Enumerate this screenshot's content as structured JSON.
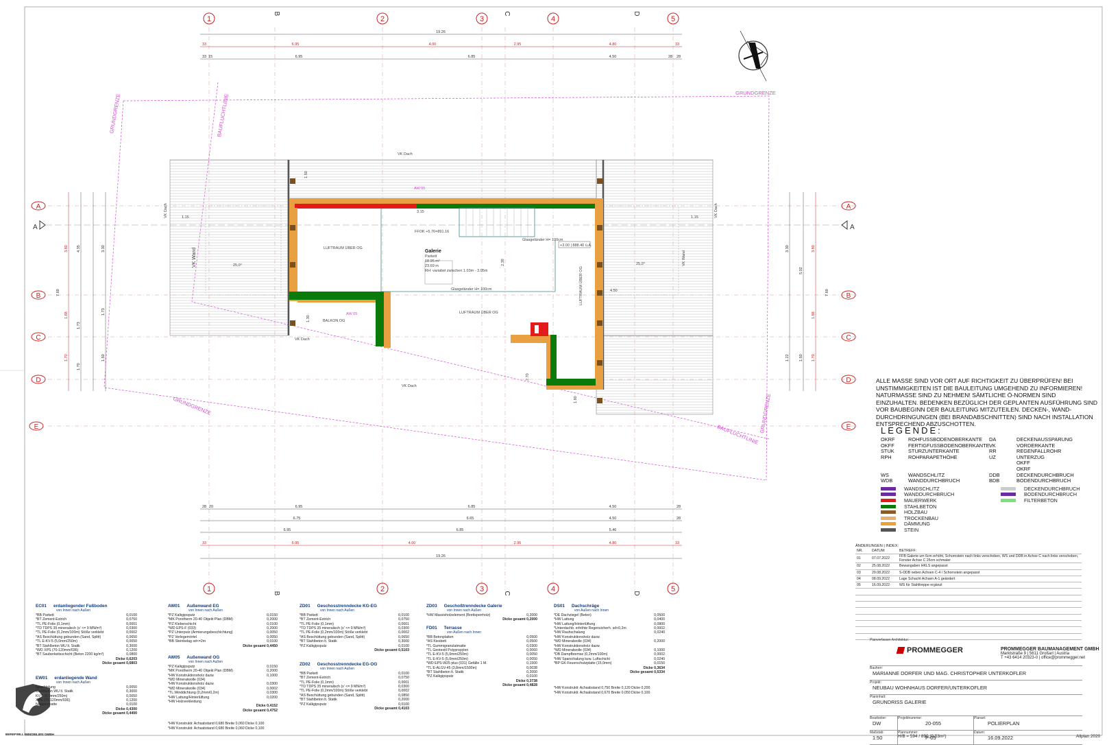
{
  "grid": {
    "x_axes": [
      "1",
      "B",
      "2",
      "3",
      "C",
      "4",
      "D",
      "5"
    ],
    "y_axes": [
      "A",
      "B",
      "C",
      "D",
      "E"
    ]
  },
  "dims_top": {
    "overall": "19.26",
    "row1": [
      "33",
      "6.95",
      "4.00",
      "2.95",
      "4.80",
      "33"
    ],
    "row2": [
      "33",
      "15",
      "6.95",
      "6.85",
      "4.50",
      "28",
      "28"
    ]
  },
  "dims_bottom": {
    "row1": [
      "28",
      "20",
      "6.95",
      "6.85",
      "4.50",
      "28"
    ],
    "row2": [
      "6.75",
      "6.65",
      "4.50",
      "28"
    ],
    "row3": [
      "6.95",
      "6.85",
      "5.46"
    ],
    "row4": [
      "33",
      "6.95",
      "4.00",
      "2.95",
      "4.80",
      "33"
    ],
    "overall": "19.26"
  },
  "dims_left": [
    "3.80",
    "4.35",
    "3.30",
    "1.68",
    "1.73",
    "1.70",
    "1.50",
    "1.70",
    "7.69"
  ],
  "dims_right": [
    "3.30",
    "3.80",
    "5.02",
    "1.88",
    "1.50",
    "1.70",
    "1.22",
    "7.69"
  ],
  "plan_labels": {
    "grundgrenze": "GRUNDGRENZE",
    "baufluchtlinie": "BAUFLUCHTLINIE",
    "vk_dach": "VK Dach",
    "vk_wand": "VK Wand",
    "luftraum_og": "LUFTRAUM ÜBER OG",
    "luftraum_og2": "LUFTRAUM ÜBER OG",
    "balkon": "BALKON OG",
    "ffok": "FFOK +5.76=891.16",
    "room_name": "Galerie",
    "room_floor": "Parkett",
    "room_area1": "18.95 m²",
    "room_area2": "23.69 m",
    "room_rh": "RH: variabel zwischen 1.03m - 3.05m",
    "glas1": "Glasgeländer H= 100cm",
    "glas2": "Glasgeländer H= 100cm",
    "level": "+3.00 | 888.40 ü.A.",
    "aw_tag1": "AW 05",
    "aw_tag2": "AW 05",
    "slope": "25,0°",
    "slope2": "25,0°",
    "section": "A",
    "dim_115": "1.15",
    "dim_315": "3.15",
    "dim_150": "1.50",
    "dim_130": "1.30",
    "dim_239": "2.39",
    "dim_450": "4.50",
    "dim_270": "2.70",
    "dim_180": "1.80"
  },
  "notes": "ALLE MASSE SIND VOR ORT AUF RICHTIGKEIT ZU ÜBERPRÜFEN! BEI UNSTIMMIGKEITEN IST DIE BAULEITUNG UMGEHEND ZU INFORMIEREN! NATURMASSE SIND ZU NEHMEN! SÄMTLICHE Ö-NORMEN SIND EINZUHALTEN. BEDENKEN BEZÜGLICH DER GEPLANTEN AUSFÜHRUNG SIND VOR BAUBEGINN DER BAULEITUNG MITZUTEILEN. DECKEN-, WAND-DURCHDRINGUNGEN (BEI BRANDABSCHNITTEN) SIND NACH INSTALLATION ENTSPRECHEND ABZUSCHOTTEN.",
  "legend": {
    "title": "LEGENDE:",
    "abbr": [
      [
        "OKRF",
        "ROHFUSSBODENOBERKANTE",
        "DA",
        "DECKENAUSSPARUNG"
      ],
      [
        "OKFF",
        "FERTIGFUSSBODENOBERKANTE",
        "VK",
        "VORDERKANTE"
      ],
      [
        "STUK",
        "STURZUNTERKANTE",
        "RR",
        "REGENFALLROHR"
      ],
      [
        "RPH",
        "ROHPARAPETHÖHE",
        "UZ",
        "UNTERZUG"
      ],
      [
        "",
        "",
        "",
        "OKFF"
      ],
      [
        "",
        "",
        "",
        "OKRF"
      ],
      [
        "WS",
        "WANDSCHLITZ",
        "DDB",
        "DECKENDURCHBRUCH"
      ],
      [
        "WDB",
        "WANDDURCHBRUCH",
        "BDB",
        "BODENDURCHBRUCH"
      ]
    ],
    "swatches": [
      {
        "label": "WANDSCHLITZ",
        "color": "#6a2aa0"
      },
      {
        "label": "WANDDURCHBRUCH",
        "color": "#6a2aa0"
      },
      {
        "label": "MAUERWERK",
        "color": "#e31b1b"
      },
      {
        "label": "STAHLBETON",
        "color": "#0a7a0a"
      },
      {
        "label": "HOLZBAU",
        "color": "#8a5a2a"
      },
      {
        "label": "TROCKENBAU",
        "color": "#e8b070"
      },
      {
        "label": "DÄMMUNG",
        "color": "#f0a030"
      },
      {
        "label": "STEIN",
        "color": "#555555"
      }
    ],
    "swatches_right": [
      {
        "label": "DECKENDURCHBRUCH",
        "color": "#cccccc"
      },
      {
        "label": "BODENDURCHBRUCH",
        "color": "#6a2aa0"
      },
      {
        "label": "FILTERBETON",
        "color": "#7de07d"
      }
    ]
  },
  "changes": {
    "title": "ÄNDERUNGEN | INDEX:",
    "headers": [
      "NR.",
      "DATUM:",
      "BETREFF:"
    ],
    "rows": [
      [
        "01",
        "07.07.2022",
        "FFB Galerie um 6cm erhöht, Schornstein nach links verschoben, WS und DDB in Achse C nach links verschoben, Fenster Achse C 25cm schmaler"
      ],
      [
        "02",
        "25.08.2022",
        "Bewangaben HKLS angepasst"
      ],
      [
        "03",
        "29.08.2022",
        "S-DDB neben Achsen C-4 / Schornstein angepasst"
      ],
      [
        "04",
        "08.09.2022",
        "Lage Schacht Achsen A-1 geändert"
      ],
      [
        "05",
        "16.09.2022",
        "WS für Stahltreppe ergänzt"
      ]
    ]
  },
  "titleblock": {
    "architect_label": "Planverfasser Architektur:",
    "logo": "PROMMEGGER",
    "company": "PROMMEGGER BAUMANAGEMENT GMBH",
    "address": "Marktstraße 9 | 5611 Großarl | Austria",
    "contact": "T +43 6414 20323-0 | office@prommegger.net",
    "bauherr_label": "Bauherr:",
    "bauherr": "MARIANNE DORFER UND MAG. CHRISTOPHER UNTERKOFLER",
    "projekt_label": "Projekt:",
    "projekt": "NEUBAU WOHNHAUS DORFER/UNTERKOFLER",
    "planinhalt_label": "Planinhalt:",
    "planinhalt": "GRUNDRISS GALERIE",
    "bearbeiter_label": "Bearbeiter:",
    "bearbeiter": "DW",
    "projektnr_label": "Projektnummer:",
    "projektnr": "20-055",
    "planart_label": "Planart:",
    "planart": "POLIERPLAN",
    "massstab_label": "Maßstab:",
    "massstab": "1:50",
    "plannr_label": "Plannummer:",
    "plannr": "P-05",
    "datum_label": "Datum:",
    "datum": "16.09.2022",
    "hb": "H/B = 594 / 890 (0.53m²)",
    "software": "Allplan 2020"
  },
  "brand": "BEREFWILL IMMOBILIEN GMBH",
  "schedules": [
    {
      "code": "EC01",
      "title": "erdanliegender Fußboden",
      "sub": "von Innen nach Außen",
      "lines": [
        [
          "*BB Parkett",
          "0,0100"
        ],
        [
          "*BT Zement-Estrich",
          "0,0750"
        ],
        [
          "*TL PE-Folie (0,1mm)",
          "0,0001"
        ],
        [
          "*TD TDPS 35 mineralisch (s' <= 9 MN/m³)",
          "0,0300"
        ],
        [
          "*TL PE-Folie (0,2mm/100m) Stöße verklebt",
          "0,0002"
        ],
        [
          "*AS Beschüttung gebunden (Sand, Splitt)",
          "0,0650"
        ],
        [
          "*TL E-KV-5 (5,0mm/250m)",
          "0,0050"
        ],
        [
          "*BT Stahlbeton WU lt. Statik",
          "0,3000"
        ],
        [
          "*WD XPS (70-120mm/036)",
          "0,1200"
        ],
        [
          "*BT Sauberkeitsschicht (Beton 2200 kg/m³)",
          "0,0800"
        ]
      ],
      "tot1": "Dicke 0,6203",
      "tot2": "Dicke gesamt 0,6803"
    },
    {
      "code": "EW01",
      "title": "erdanliegende Wand",
      "sub": "von Innen nach Außen",
      "lines": [
        [
          "Spachtelung",
          "0,0050"
        ],
        [
          "Stahlbeton WU lt. Statik",
          "0,3000"
        ],
        [
          "KV-5 (5,0mm/250m)",
          "0,0050"
        ],
        [
          "XPS (70-120mm/036)",
          "0,1200"
        ],
        [
          "Noppenmatte",
          "0,0100"
        ]
      ],
      "tot1": "Dicke 0,4300",
      "tot2": "Dicke gesamt 0,4400"
    },
    {
      "code": "AW01",
      "title": "Außenwand EG",
      "sub": "von Innen nach Außen",
      "lines": [
        [
          "*PZ Kalkgipsputz",
          "0,0150"
        ],
        [
          "*MK Porotherm 20-40 Objekt Plan (DBM)",
          "0,2000"
        ],
        [
          "*PZ Kleberschicht",
          "0,0100"
        ],
        [
          "*WD EPS-F (033)",
          "0,2000"
        ],
        [
          "*PZ Unterputz (Armierungsbeschichtung)",
          "0,0050"
        ],
        [
          "*PZ Verlegemörtel",
          "0,0050"
        ],
        [
          "*BB Steinbelag sd<=2m",
          "0,0100"
        ]
      ],
      "tot1": "",
      "tot2": "Dicke gesamt 0,4450"
    },
    {
      "code": "AW05",
      "title": "Außenwand OG",
      "sub": "von Innen nach Außen",
      "lines": [
        [
          "*PZ Kalkgipsputz",
          "0,0150"
        ],
        [
          "*MK Porotherm 20-40 Objekt Plan (DBM)",
          "0,2000"
        ],
        [
          "*HW Konstruktionsholz dazw.",
          "0,1000"
        ],
        [
          "*WD Mineralwolle (034)",
          ""
        ],
        [
          "*HW Konstruktionsholz dazw.",
          "0,0300"
        ],
        [
          "*WD Mineralwolle (034)",
          "0,0002"
        ],
        [
          "*TL Winddichtung (0,2mm/0,2m)",
          "0,0300"
        ],
        [
          "*HW Lattung/Hinterlüftung",
          "0,0200"
        ],
        [
          "*HW Holzverkleidung",
          ""
        ]
      ],
      "tot1": "Dicke 0,4152",
      "tot2": "Dicke gesamt 0,4752"
    },
    {
      "code": "ZD01",
      "title": "Geschosstrenndecke KG-EG",
      "sub": "von Innen nach Außen",
      "lines": [
        [
          "*BB Parkett",
          "0,0100"
        ],
        [
          "*BT Zement-Estrich",
          "0,0750"
        ],
        [
          "*TL PE-Folie (0,1mm)",
          "0,0001"
        ],
        [
          "*TD TDPS 35 mineralisch (s' <= 9 MN/m³)",
          "0,0300"
        ],
        [
          "*TL PE-Folie (0,2mm/100m) Stöße verklebt",
          "0,0002"
        ],
        [
          "*AS Beschüttung gebunden (Sand, Splitt)",
          "0,0650"
        ],
        [
          "*BT Stahlbeton lt. Statik",
          "0,3000"
        ],
        [
          "*PZ Kalkgipsputz",
          "0,0100"
        ]
      ],
      "tot1": "",
      "tot2": "Dicke gesamt 0,5103"
    },
    {
      "code": "ZD02",
      "title": "Geschosstrenndecke EG-OG",
      "sub": "von Innen nach Außen",
      "lines": [
        [
          "*BB Parkett",
          "0,0100"
        ],
        [
          "*BT Zement-Estrich",
          "0,0750"
        ],
        [
          "*TL PE-Folie (0,1mm)",
          "0,0001"
        ],
        [
          "*TD TDPS 35 mineralisch (s' <= 9 MN/m³)",
          "0,0300"
        ],
        [
          "*TL PE-Folie (0,2mm/100m) Stöße verklebt",
          "0,0002"
        ],
        [
          "*AS Beschüttung gebunden (Sand, Splitt)",
          "0,0850"
        ],
        [
          "*BT Stahlbeton lt. Statik",
          "0,2000"
        ],
        [
          "*PZ Kalkgipsputz",
          "0,0100"
        ]
      ],
      "tot1": "",
      "tot2": "Dicke gesamt 0,4103"
    },
    {
      "code": "ZD03",
      "title": "Geschoßtrenndecke Galerie",
      "sub": "von Innen nach Außen",
      "lines": [
        [
          "*HW Massivholzelement (Brettsperrholz)",
          "0,2000"
        ]
      ],
      "tot1": "",
      "tot2": "Dicke gesamt 0,2000"
    },
    {
      "code": "FD01",
      "title": "Terrasse",
      "sub": "von Außen nach Innen",
      "lines": [
        [
          "*BB Betonplatten",
          "0,0500"
        ],
        [
          "*AS Kiesbett",
          "0,0500"
        ],
        [
          "*TL Gummigranulatmatte",
          "0,0300"
        ],
        [
          "*TL Geotextil Polypropylen",
          "0,0060"
        ],
        [
          "*TL E-KV-5 (5,0mm/250m)",
          "0,0050"
        ],
        [
          "*TL E-KV-5 (5,0mm/250m)",
          "0,0050"
        ],
        [
          "*WD EPS-W25 plus (031) Gefälle 1 M.",
          "0,1500"
        ],
        [
          "*TL E-ALGV-45 (3,8mm/1500m)",
          "0,0038"
        ],
        [
          "*BT Stahlbeton lt. Statik",
          "0,2000"
        ],
        [
          "*PZ Kalkgipsputz",
          "0,0100"
        ]
      ],
      "tot1": "Dicke 0,3738",
      "tot2": "Dicke gesamt 0,4828"
    },
    {
      "code": "DS01",
      "title": "Dachschräge",
      "sub": "von Außen nach Innen",
      "lines": [
        [
          "*DE Dachziegel (Beton)",
          "0,0500"
        ],
        [
          "*HW Lattung",
          "0,0400"
        ],
        [
          "*HW Lattung/Hinterlüftung",
          "0,0800"
        ],
        [
          "*Unterdachb. erhöhte Regensicherh. sd<0,2m",
          "0,0002"
        ],
        [
          "*HW Rauhschalung",
          "0,0240"
        ],
        [
          "*HW Konstruktionsholz dazw.",
          ""
        ],
        [
          "*WD Mineralwolle (034)",
          "0,2000"
        ],
        [
          "*HW Konstruktionsholz dazw.",
          ""
        ],
        [
          "*WD Mineralwolle (034)",
          "0,1000"
        ],
        [
          "*DB Dampfbremse (0,2mm/100m)",
          "0,0002"
        ],
        [
          "*HW Sparschalung bzw. Luftschicht",
          "0,0240"
        ],
        [
          "*BP GK-Feuerschutzplatte (15,0mm)",
          "0,0150"
        ]
      ],
      "tot1": "Dicke 0,3634",
      "tot2": "Dicke gesamt 0,5334"
    }
  ],
  "footnotes_aw05": [
    "*HW Konstrukti: Achsabstand 0,680  Breite 0,060  Dicke 0,100",
    "*HW Konstrukti: Achsabstand 0,680  Breite 0,060  Dicke 0,100"
  ],
  "footnotes_ds01": [
    "*HW Konstrukti: Achsabstand 0,750  Breite 0,120  Dicke 0,200",
    "*HW Konstrukti: Achsabstand 0,670  Breite 0,050  Dicke 0,100"
  ]
}
